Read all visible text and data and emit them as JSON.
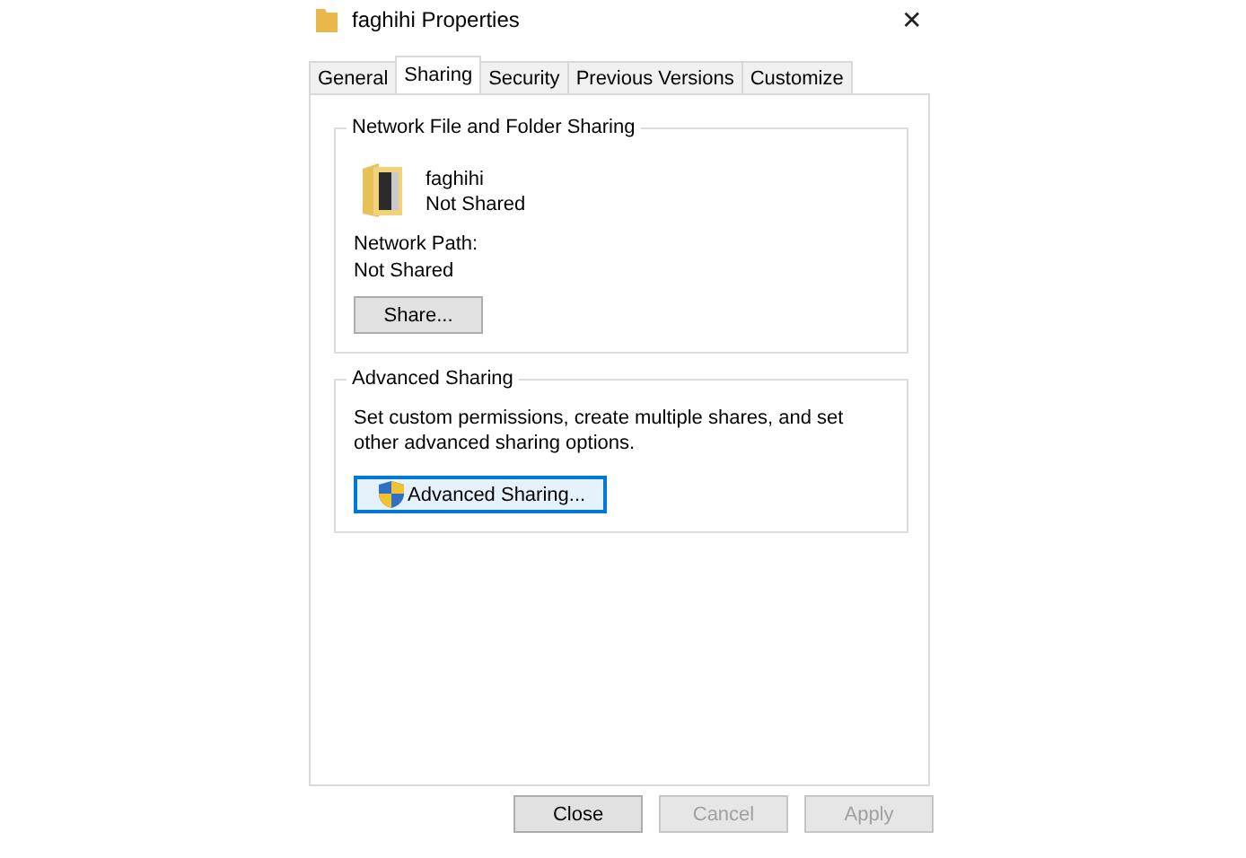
{
  "window": {
    "title": "faghihi Properties",
    "close": "✕"
  },
  "tabs": [
    {
      "label": "General",
      "selected": false
    },
    {
      "label": "Sharing",
      "selected": true
    },
    {
      "label": "Security",
      "selected": false
    },
    {
      "label": "Previous Versions",
      "selected": false
    },
    {
      "label": "Customize",
      "selected": false
    }
  ],
  "network_sharing": {
    "title": "Network File and Folder Sharing",
    "name": "faghihi",
    "status": "Not Shared",
    "path_label": "Network Path:",
    "path": "Not Shared",
    "button": "Share..."
  },
  "advanced_sharing": {
    "title": "Advanced Sharing",
    "description": "Set custom permissions, create multiple shares, and set other advanced sharing options.",
    "button": "Advanced Sharing..."
  },
  "buttons": [
    {
      "label": "Close",
      "disabled": false
    },
    {
      "label": "Cancel",
      "disabled": true
    },
    {
      "label": "Apply",
      "disabled": true
    }
  ]
}
